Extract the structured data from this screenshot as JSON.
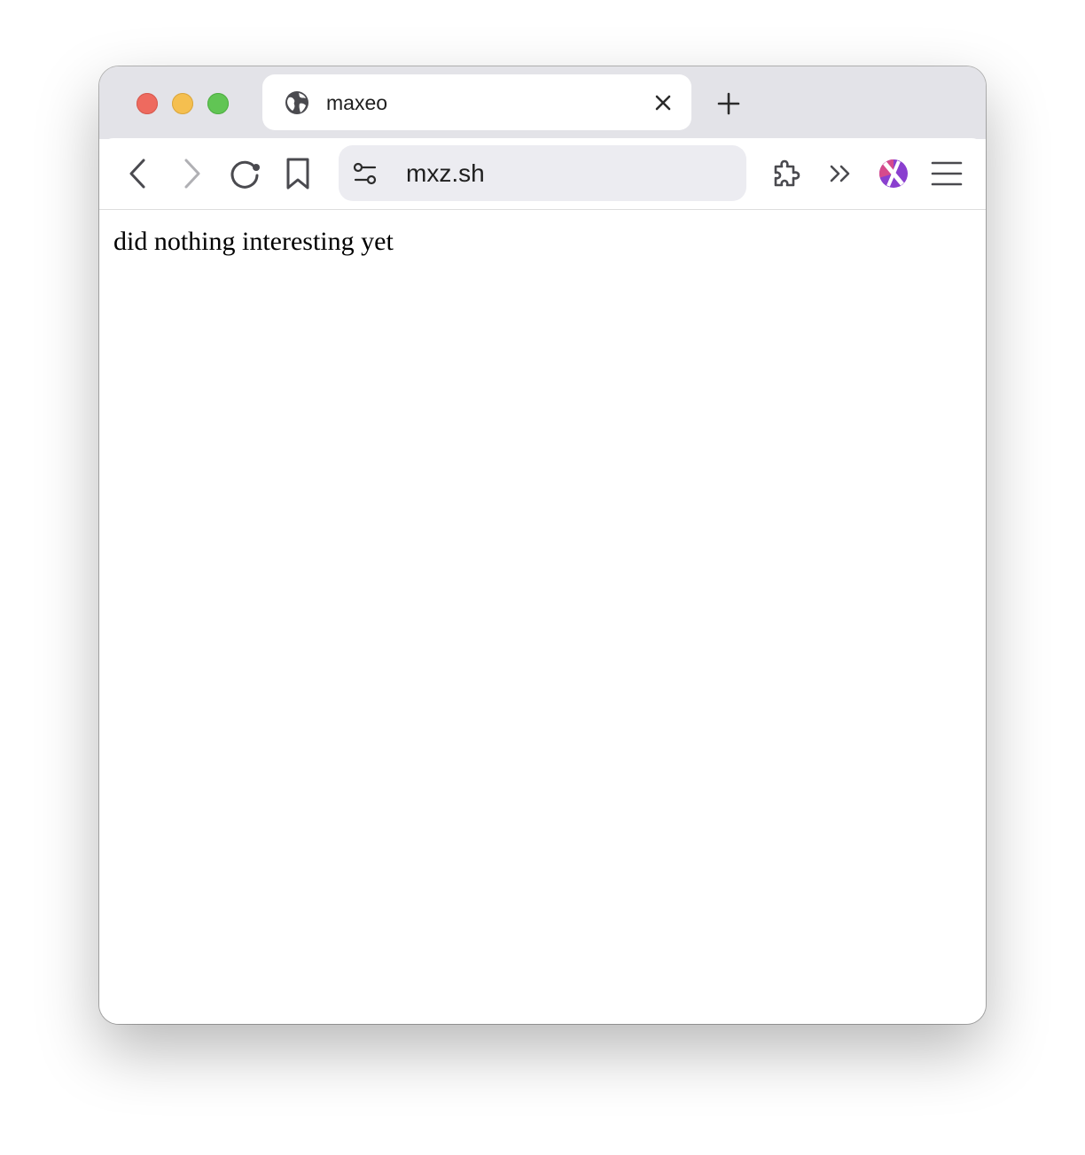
{
  "window": {
    "traffic_lights": {
      "close_color": "#ee6a5f",
      "minimize_color": "#f5bf4f",
      "zoom_color": "#61c554"
    }
  },
  "tabs": [
    {
      "title": "maxeo",
      "icon": "globe-icon",
      "active": true
    }
  ],
  "toolbar": {
    "back_icon": "chevron-left-icon",
    "forward_icon": "chevron-right-icon",
    "reload_icon": "reload-icon",
    "bookmark_icon": "bookmark-icon",
    "site_settings_icon": "tune-icon",
    "url": "mxz.sh",
    "extensions_icon": "puzzle-icon",
    "overflow_icon": "double-chevron-right-icon",
    "profile_icon": "profile-avatar-icon",
    "menu_icon": "hamburger-menu-icon"
  },
  "page": {
    "text": "did nothing interesting yet"
  }
}
